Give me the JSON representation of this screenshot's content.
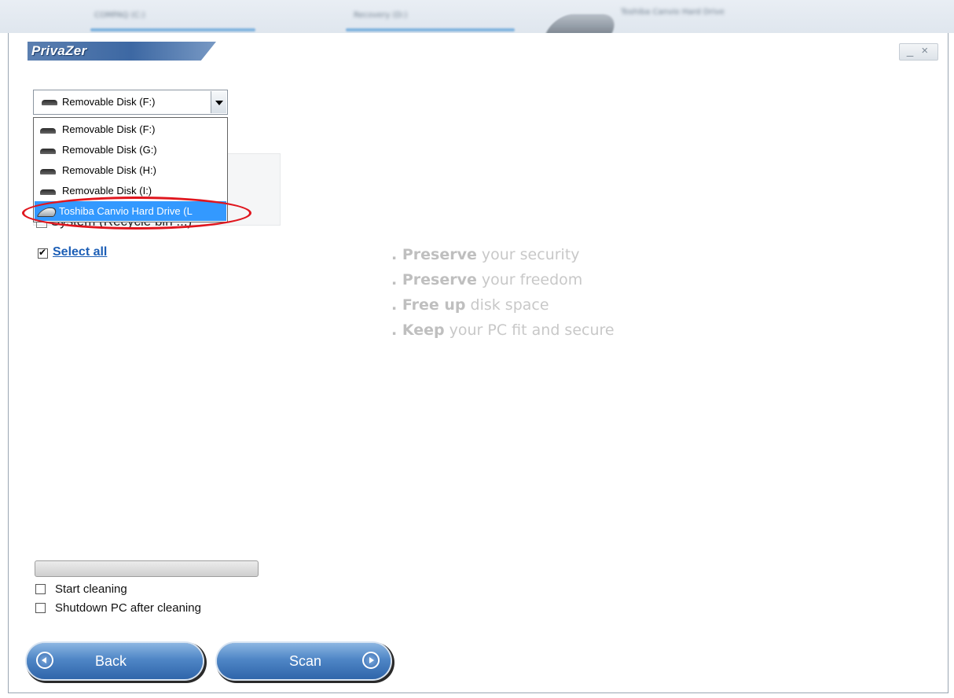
{
  "background_strip": {
    "texts": [
      "COMPAQ (C:)",
      "Recovery (D:)",
      "Toshiba Canvio Hard Drive"
    ]
  },
  "app": {
    "title": "PrivaZer",
    "window_controls": "_ ×"
  },
  "drive_select": {
    "selected_value": "Removable Disk (F:)",
    "options": [
      "Removable Disk (F:)",
      "Removable Disk (G:)",
      "Removable Disk (H:)",
      "Removable Disk (I:)",
      "Toshiba Canvio Hard Drive (L"
    ],
    "highlighted_option": "Toshiba Canvio Hard Drive (L"
  },
  "partial_list_item": "System (Recycle bin ...)",
  "select_all": {
    "label": "Select all",
    "checked": true
  },
  "taglines": [
    {
      "bold": ". Preserve",
      "rest": " your security"
    },
    {
      "bold": ". Preserve",
      "rest": " your freedom"
    },
    {
      "bold": ". Free up",
      "rest": " disk space"
    },
    {
      "bold": ". Keep",
      "rest": " your PC fit and secure"
    }
  ],
  "progress": {
    "value_percent": 0
  },
  "options": {
    "start_cleaning": {
      "label": "Start cleaning",
      "checked": false
    },
    "shutdown_after": {
      "label": "Shutdown PC after cleaning",
      "checked": false
    }
  },
  "buttons": {
    "back": "Back",
    "scan": "Scan"
  },
  "colors": {
    "accent": "#3d68a3",
    "link": "#1d5fb6",
    "selection": "#3399ff",
    "highlight_ring": "#e0161e"
  }
}
